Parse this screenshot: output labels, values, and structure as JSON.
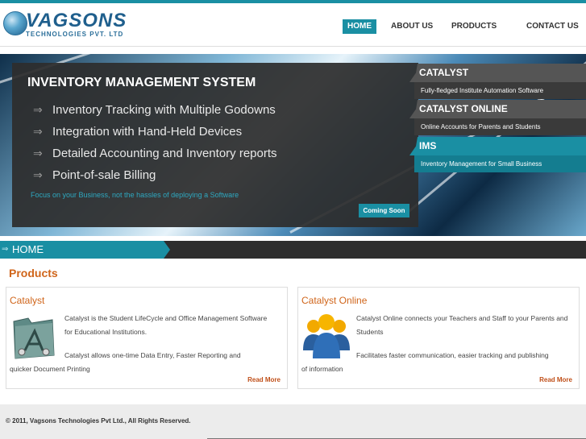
{
  "header": {
    "logo_name": "VAGSONS",
    "logo_sub": "TECHNOLOGIES PVT. LTD",
    "nav": [
      {
        "label": "HOME",
        "active": true
      },
      {
        "label": "ABOUT US",
        "active": false
      },
      {
        "label": "PRODUCTS",
        "active": false
      },
      {
        "label": "CONTACT US",
        "active": false
      }
    ]
  },
  "banner": {
    "title": "INVENTORY MANAGEMENT SYSTEM",
    "features": [
      "Inventory Tracking with Multiple Godowns",
      "Integration with Hand-Held Devices",
      "Detailed Accounting and Inventory reports",
      "Point-of-sale Billing"
    ],
    "tagline": "Focus on your Business, not the hassles of deploying a Software",
    "coming_soon": "Coming Soon",
    "tabs": [
      {
        "title": "CATALYST",
        "desc": "Fully-fledged Institute Automation Software",
        "style": "dark"
      },
      {
        "title": "CATALYST ONLINE",
        "desc": "Online Accounts for Parents and Students",
        "style": "dark"
      },
      {
        "title": "IMS",
        "desc": "Inventory Management for Small Business",
        "style": "teal"
      }
    ]
  },
  "breadcrumb": {
    "label": "HOME"
  },
  "products": {
    "title": "Products",
    "cards": [
      {
        "title": "Catalyst",
        "para1": "Catalyst is the Student LifeCycle and Office Management Software for Educational Institutions.",
        "para2_line1": "Catalyst allows one-time Data Entry, Faster Reporting and",
        "para2_line2": "quicker Document Printing",
        "read_more": "Read More",
        "icon": "folder-app-icon"
      },
      {
        "title": "Catalyst Online",
        "para1": "Catalyst Online connects your Teachers and Staff to your Parents and Students",
        "para2_line1": "Facilitates faster communication, easier tracking and publishing",
        "para2_line2": "of information",
        "read_more": "Read More",
        "icon": "people-group-icon"
      }
    ]
  },
  "footer": {
    "copyright": "© 2011, Vagsons Technologies Pvt Ltd., All Rights Reserved."
  },
  "colors": {
    "accent": "#1a8fa3",
    "orange": "#d0651a",
    "dark": "#2d2d2d"
  }
}
